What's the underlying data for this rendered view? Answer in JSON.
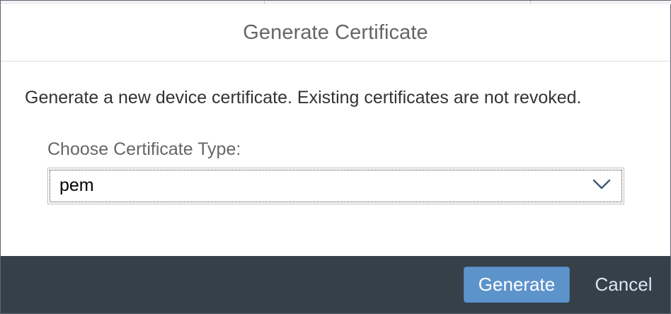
{
  "dialog": {
    "title": "Generate Certificate",
    "description": "Generate a new device certificate. Existing certificates are not revoked.",
    "certificate_type": {
      "label": "Choose Certificate Type:",
      "selected_value": "pem",
      "icon": "chevron-down-icon"
    },
    "footer": {
      "generate_label": "Generate",
      "cancel_label": "Cancel"
    }
  },
  "colors": {
    "footer_background": "#354049",
    "primary_button": "#5d93cb",
    "cancel_text": "#d6e6f5",
    "title_text": "#666666"
  }
}
